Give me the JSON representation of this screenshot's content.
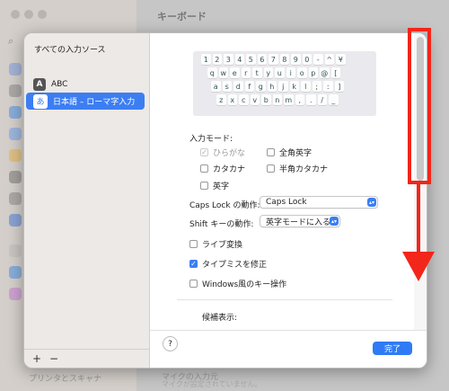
{
  "background": {
    "title": "キーボード",
    "bottom_label": "プリンタとスキャナ",
    "mic_label": "マイクの入力元",
    "mic_status": "マイクが設定されていません。"
  },
  "sources": {
    "header": "すべての入力ソース",
    "items": [
      {
        "badge": "A",
        "label": "ABC",
        "selected": false
      },
      {
        "badge": "あ",
        "label": "日本語 – ローマ字入力",
        "selected": true
      }
    ],
    "add_label": "+",
    "remove_label": "−"
  },
  "keyboard": {
    "rows": [
      [
        "1",
        "2",
        "3",
        "4",
        "5",
        "6",
        "7",
        "8",
        "9",
        "0",
        "-",
        "^",
        "¥"
      ],
      [
        "q",
        "w",
        "e",
        "r",
        "t",
        "y",
        "u",
        "i",
        "o",
        "p",
        "@",
        "["
      ],
      [
        "a",
        "s",
        "d",
        "f",
        "g",
        "h",
        "j",
        "k",
        "l",
        ";",
        ":",
        "]"
      ],
      [
        "z",
        "x",
        "c",
        "v",
        "b",
        "n",
        "m",
        ",",
        ".",
        "/",
        "_"
      ]
    ]
  },
  "input_mode": {
    "label": "入力モード:",
    "options": [
      {
        "label": "ひらがな",
        "checked": true,
        "disabled": true
      },
      {
        "label": "全角英字",
        "checked": false,
        "disabled": false
      },
      {
        "label": "カタカナ",
        "checked": false,
        "disabled": false
      },
      {
        "label": "半角カタカナ",
        "checked": false,
        "disabled": false
      },
      {
        "label": "英字",
        "checked": false,
        "disabled": false
      }
    ]
  },
  "caps_lock": {
    "label": "Caps Lock の動作:",
    "value": "Caps Lock"
  },
  "shift_key": {
    "label": "Shift キーの動作:",
    "value": "英字モードに入る"
  },
  "checkboxes": [
    {
      "label": "ライブ変換",
      "checked": false
    },
    {
      "label": "タイプミスを修正",
      "checked": true
    },
    {
      "label": "Windows風のキー操作",
      "checked": false
    }
  ],
  "candidates": {
    "label": "候補表示:"
  },
  "footer": {
    "help_label": "?",
    "done_label": "完了"
  },
  "colors": {
    "accent": "#3a7ef5",
    "annotation": "#f2261a"
  }
}
